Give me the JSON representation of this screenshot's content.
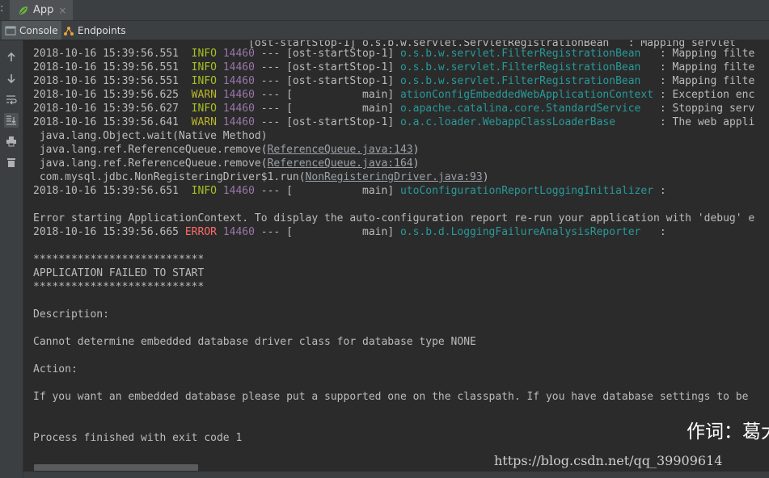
{
  "window": {
    "prefix_glyph": ":",
    "run_tab_label": "App",
    "run_tab_close": "×"
  },
  "tool_tabs": {
    "console_label": "Console",
    "endpoints_label": "Endpoints"
  },
  "console": {
    "cut_top_line": "                                  [ost-startStop-1] o.s.b.w.servlet.ServletRegistrationBean   : Mapping servlet",
    "lines": [
      {
        "ts": "2018-10-16 15:39:56.551",
        "level": "INFO",
        "pid": "14460",
        "thread": " --- [ost-startStop-1] ",
        "logger": "o.s.b.w.servlet.FilterRegistrationBean",
        "msg": "   : Mapping filte"
      },
      {
        "ts": "2018-10-16 15:39:56.551",
        "level": "INFO",
        "pid": "14460",
        "thread": " --- [ost-startStop-1] ",
        "logger": "o.s.b.w.servlet.FilterRegistrationBean",
        "msg": "   : Mapping filte"
      },
      {
        "ts": "2018-10-16 15:39:56.551",
        "level": "INFO",
        "pid": "14460",
        "thread": " --- [ost-startStop-1] ",
        "logger": "o.s.b.w.servlet.FilterRegistrationBean",
        "msg": "   : Mapping filte"
      },
      {
        "ts": "2018-10-16 15:39:56.625",
        "level": "WARN",
        "pid": "14460",
        "thread": " --- [           main] ",
        "logger": "ationConfigEmbeddedWebApplicationContext",
        "msg": " : Exception enc"
      },
      {
        "ts": "2018-10-16 15:39:56.627",
        "level": "INFO",
        "pid": "14460",
        "thread": " --- [           main] ",
        "logger": "o.apache.catalina.core.StandardService",
        "msg": "   : Stopping serv"
      },
      {
        "ts": "2018-10-16 15:39:56.641",
        "level": "WARN",
        "pid": "14460",
        "thread": " --- [ost-startStop-1] ",
        "logger": "o.a.c.loader.WebappClassLoaderBase",
        "msg": "       : The web appli"
      }
    ],
    "stack": [
      {
        "text": " java.lang.Object.wait(Native Method)",
        "link": ""
      },
      {
        "text": " java.lang.ref.ReferenceQueue.remove(",
        "link": "ReferenceQueue.java:143",
        "after": ")"
      },
      {
        "text": " java.lang.ref.ReferenceQueue.remove(",
        "link": "ReferenceQueue.java:164",
        "after": ")"
      },
      {
        "text": " com.mysql.jdbc.NonRegisteringDriver$1.run(",
        "link": "NonRegisteringDriver.java:93",
        "after": ")"
      }
    ],
    "line_after_stack": {
      "ts": "2018-10-16 15:39:56.651",
      "level": "INFO",
      "pid": "14460",
      "thread": " --- [           main] ",
      "logger": "utoConfigurationReportLoggingInitializer",
      "msg": " :"
    },
    "error_context_msg": "Error starting ApplicationContext. To display the auto-configuration report re-run your application with 'debug' e",
    "error_line": {
      "ts": "2018-10-16 15:39:56.665",
      "level": "ERROR",
      "pid": "14460",
      "thread": " --- [           main] ",
      "logger": "o.s.b.d.LoggingFailureAnalysisReporter",
      "msg": "   :"
    },
    "stars": "***************************",
    "failed_title": "APPLICATION FAILED TO START",
    "description_label": "Description:",
    "description_text": "Cannot determine embedded database driver class for database type NONE",
    "action_label": "Action:",
    "action_text": "If you want an embedded database please put a supported one on the classpath. If you have database settings to be",
    "process_finished": "Process finished with exit code 1"
  },
  "overlay": {
    "cn_text": "作词：葛大",
    "watermark": "https://blog.csdn.net/qq_39909614"
  },
  "colors": {
    "info": "#a8c023",
    "warn": "#bbb529",
    "error": "#ff6b68",
    "pid": "#9876aa",
    "logger": "#299999",
    "background": "#2b2b2b"
  },
  "icons": {
    "gutter": [
      "arrow-up-icon",
      "arrow-down-icon",
      "soft-wrap-icon",
      "scroll-to-end-icon",
      "print-icon",
      "trash-icon"
    ]
  }
}
